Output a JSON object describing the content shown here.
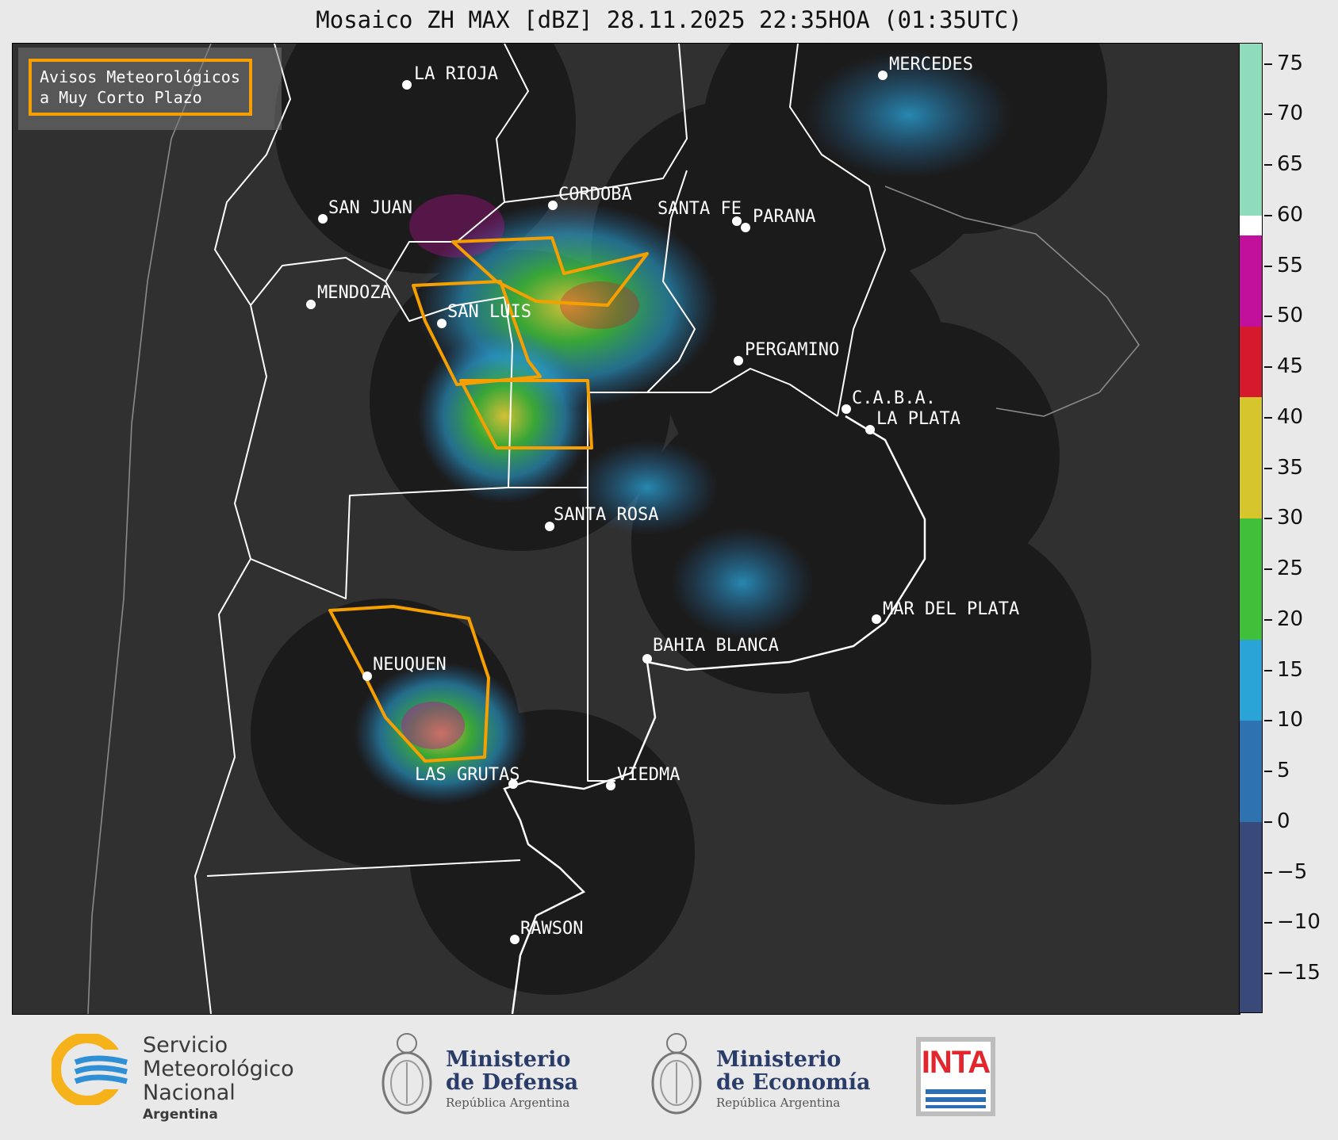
{
  "title": "Mosaico ZH MAX [dBZ] 28.11.2025 22:35HOA (01:35UTC)",
  "notice": {
    "line1": "Avisos Meteorológicos",
    "line2": "a Muy Corto Plazo",
    "color": "#f5a000"
  },
  "cities": [
    {
      "name": "LA RIOJA"
    },
    {
      "name": "MERCEDES"
    },
    {
      "name": "CORDOBA"
    },
    {
      "name": "SAN JUAN"
    },
    {
      "name": "SANTA FE"
    },
    {
      "name": "PARANA"
    },
    {
      "name": "MENDOZA"
    },
    {
      "name": "SAN LUIS"
    },
    {
      "name": "PERGAMINO"
    },
    {
      "name": "C.A.B.A."
    },
    {
      "name": "LA PLATA"
    },
    {
      "name": "SANTA ROSA"
    },
    {
      "name": "MAR DEL PLATA"
    },
    {
      "name": "BAHIA BLANCA"
    },
    {
      "name": "NEUQUEN"
    },
    {
      "name": "LAS GRUTAS"
    },
    {
      "name": "VIEDMA"
    },
    {
      "name": "RAWSON"
    }
  ],
  "colorbar": {
    "unit": "dBZ",
    "range": [
      -19,
      77
    ],
    "ticks": [
      "75",
      "70",
      "65",
      "60",
      "55",
      "50",
      "45",
      "40",
      "35",
      "30",
      "25",
      "20",
      "15",
      "10",
      "5",
      "0",
      "−5",
      "−10",
      "−15"
    ],
    "tick_values": [
      75,
      70,
      65,
      60,
      55,
      50,
      45,
      40,
      35,
      30,
      25,
      20,
      15,
      10,
      5,
      0,
      -5,
      -10,
      -15
    ],
    "bands": [
      {
        "from": -19,
        "to": 0,
        "color": "#38497a"
      },
      {
        "from": 0,
        "to": 10,
        "color": "#2f72b0"
      },
      {
        "from": 10,
        "to": 18,
        "color": "#2aa3d6"
      },
      {
        "from": 18,
        "to": 30,
        "color": "#3fbf3a"
      },
      {
        "from": 30,
        "to": 42,
        "color": "#d6c52c"
      },
      {
        "from": 42,
        "to": 49,
        "color": "#d41a2c"
      },
      {
        "from": 49,
        "to": 58,
        "color": "#c0109c"
      },
      {
        "from": 58,
        "to": 60,
        "color": "#ffffff"
      },
      {
        "from": 60,
        "to": 77,
        "color": "#8fdcbc"
      }
    ]
  },
  "logos": {
    "smn": {
      "line1": "Servicio",
      "line2": "Meteorológico",
      "line3": "Nacional",
      "line4": "Argentina"
    },
    "defensa": {
      "line1": "Ministerio",
      "line2": "de Defensa",
      "line3": "República Argentina"
    },
    "economia": {
      "line1": "Ministerio",
      "line2": "de Economía",
      "line3": "República Argentina"
    },
    "inta": {
      "text": "INTA"
    }
  }
}
